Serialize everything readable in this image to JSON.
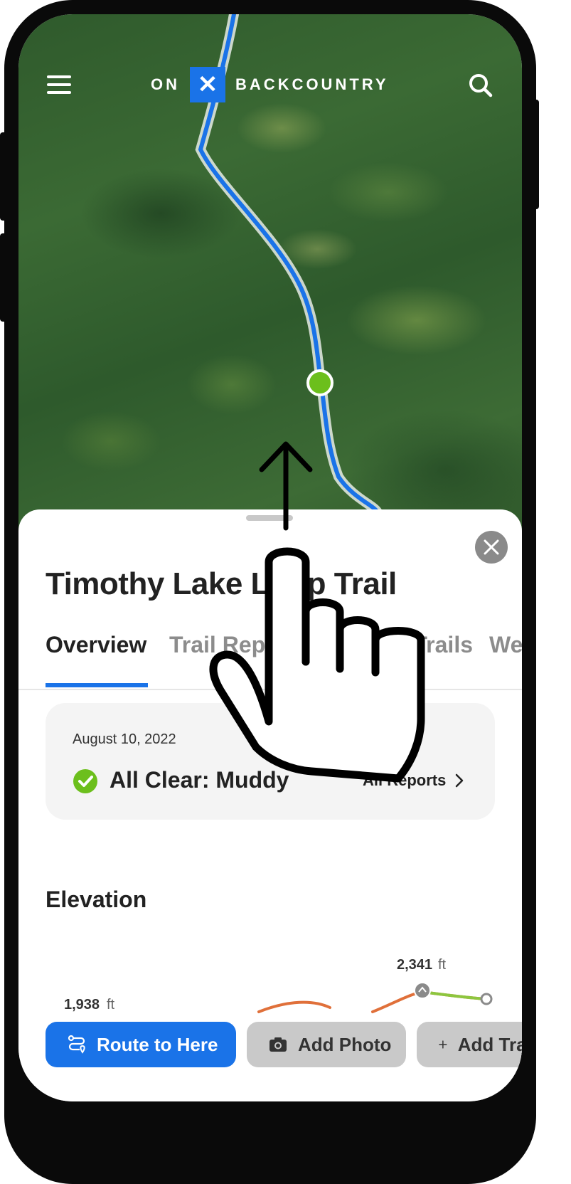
{
  "header": {
    "logo_left": "ON",
    "logo_mark": "✕",
    "logo_right": "BACKCOUNTRY"
  },
  "trail": {
    "title": "Timothy Lake Loop Trail"
  },
  "tabs": [
    {
      "label": "Overview"
    },
    {
      "label": "Trail Reports"
    },
    {
      "label": "Nearby Trails"
    },
    {
      "label": "Weather"
    }
  ],
  "report": {
    "date": "August 10, 2022",
    "status": "All Clear: Muddy",
    "link_label": "All Reports"
  },
  "elevation": {
    "heading": "Elevation",
    "max_value": "2,341",
    "max_unit": "ft",
    "min_value": "1,938",
    "min_unit": "ft"
  },
  "actions": {
    "route_label": "Route to Here",
    "photo_label": "Add Photo",
    "trail_label": "Add Trail Report"
  },
  "colors": {
    "accent": "#1a73e8",
    "trail_line": "#1a73e8",
    "status_ok": "#6cbf1c",
    "map_base": "#2f5a2c"
  },
  "icons": {
    "menu": "menu-icon",
    "search": "search-icon",
    "close": "close-icon",
    "status": "check-circle-icon",
    "chevron": "chevron-right-icon",
    "route": "route-icon",
    "camera": "camera-icon",
    "plus": "plus-icon",
    "gesture": "swipe-up-hand-icon"
  }
}
